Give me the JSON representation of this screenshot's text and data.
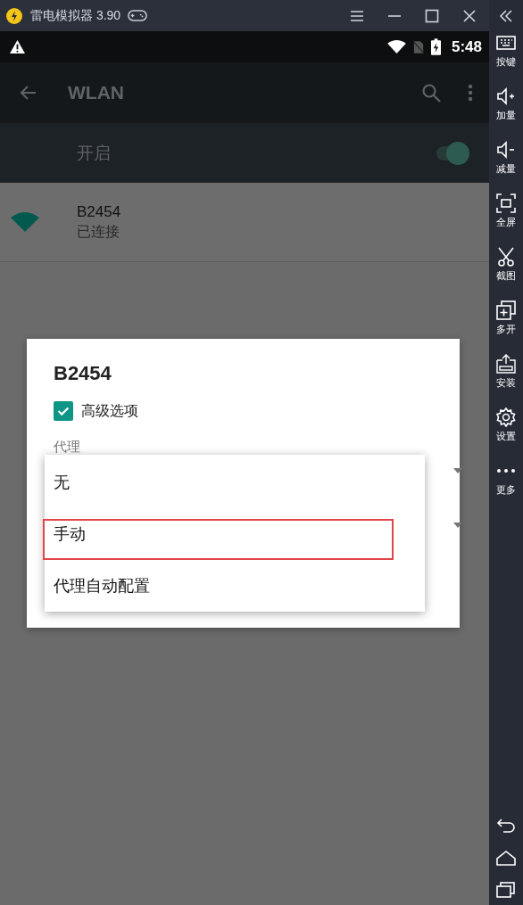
{
  "window": {
    "title": "雷电模拟器 3.90"
  },
  "status_bar": {
    "time": "5:48"
  },
  "toolbar": {
    "title": "WLAN"
  },
  "wlan_switch": {
    "label": "开启",
    "on": true
  },
  "network": {
    "name": "B2454",
    "status": "已连接"
  },
  "dialog": {
    "title": "B2454",
    "advanced": {
      "label": "高级选项",
      "checked": true
    },
    "proxy_label": "代理",
    "menu": [
      {
        "label": "无",
        "highlighted": false
      },
      {
        "label": "手动",
        "highlighted": true
      },
      {
        "label": "代理自动配置",
        "highlighted": false
      }
    ]
  },
  "sidebar": {
    "items": [
      {
        "kind": "keyboard",
        "label": "按键"
      },
      {
        "kind": "volup",
        "label": "加量"
      },
      {
        "kind": "voldown",
        "label": "减量"
      },
      {
        "kind": "fullscreen",
        "label": "全屏"
      },
      {
        "kind": "screenshot",
        "label": "截图"
      },
      {
        "kind": "multi",
        "label": "多开"
      },
      {
        "kind": "install",
        "label": "安装"
      },
      {
        "kind": "settings",
        "label": "设置"
      },
      {
        "kind": "more",
        "label": "更多"
      }
    ]
  }
}
